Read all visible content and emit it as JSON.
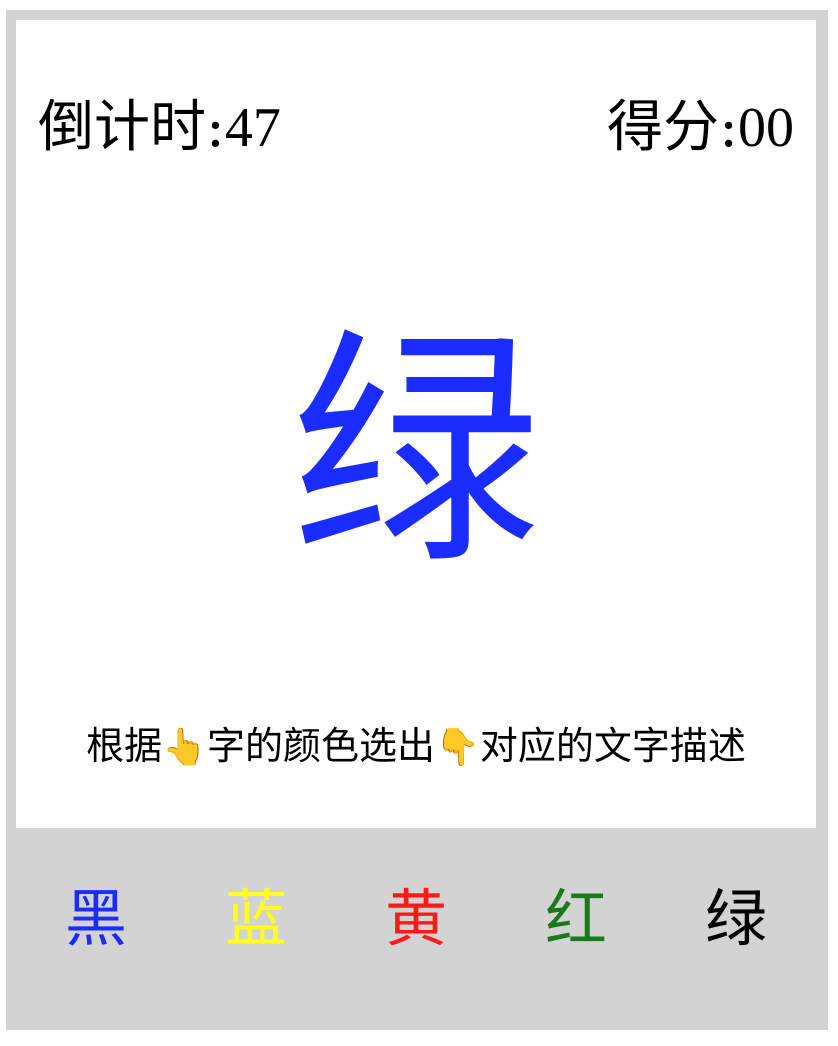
{
  "hud": {
    "countdown_label": "倒计时:",
    "countdown_value": "47",
    "score_label": "得分:",
    "score_value": "00"
  },
  "target": {
    "word": "绿",
    "color": "#1a2cff"
  },
  "instruction": {
    "part1": "根据",
    "hand_up": "👆",
    "part2": "字的颜色选出",
    "hand_down": "👇",
    "part3": "对应的文字描述"
  },
  "options": [
    {
      "text": "黑",
      "color": "#1a2cff"
    },
    {
      "text": "蓝",
      "color": "#ffff1a"
    },
    {
      "text": "黄",
      "color": "#ff1a1a"
    },
    {
      "text": "红",
      "color": "#1a7a1a"
    },
    {
      "text": "绿",
      "color": "#000000"
    }
  ],
  "colors": {
    "frame": "#d3d3d3",
    "board": "#ffffff"
  }
}
